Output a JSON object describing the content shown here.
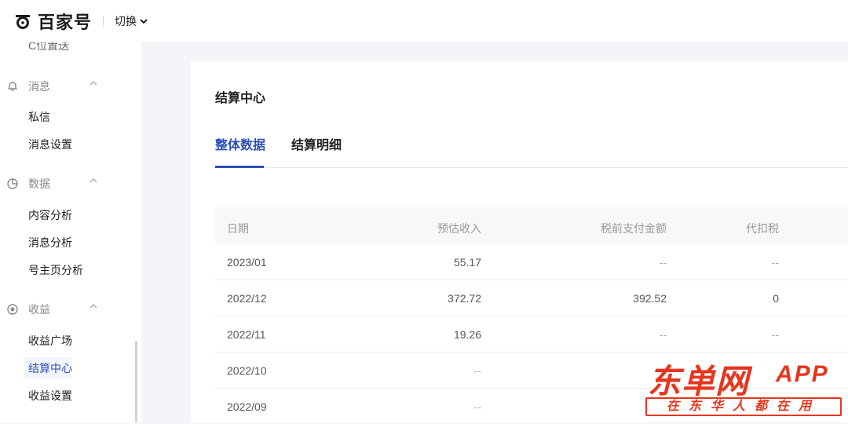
{
  "header": {
    "logo_text": "百家号",
    "switch_label": "切换"
  },
  "sidebar": {
    "cut_item": "C位置送",
    "groups": [
      {
        "label": "消息",
        "items": [
          "私信",
          "消息设置"
        ]
      },
      {
        "label": "数据",
        "items": [
          "内容分析",
          "消息分析",
          "号主页分析"
        ]
      },
      {
        "label": "收益",
        "items": [
          "收益广场",
          "结算中心",
          "收益设置"
        ]
      }
    ],
    "active_item": "结算中心"
  },
  "main": {
    "title": "结算中心",
    "tabs": [
      {
        "label": "整体数据",
        "active": true
      },
      {
        "label": "结算明细",
        "active": false
      }
    ],
    "table": {
      "columns": [
        "日期",
        "预估收入",
        "税前支付金额",
        "代扣税"
      ],
      "rows": [
        [
          "2023/01",
          "55.17",
          "--",
          "--"
        ],
        [
          "2022/12",
          "372.72",
          "392.52",
          "0"
        ],
        [
          "2022/11",
          "19.26",
          "--",
          "--"
        ],
        [
          "2022/10",
          "--",
          "",
          ""
        ],
        [
          "2022/09",
          "--",
          "",
          ""
        ]
      ]
    }
  },
  "watermark": {
    "main": "东单网",
    "app": "APP",
    "sub": "在东华人都在用"
  },
  "colors": {
    "accent": "#2d4fb8",
    "watermark": "#e5361e"
  }
}
